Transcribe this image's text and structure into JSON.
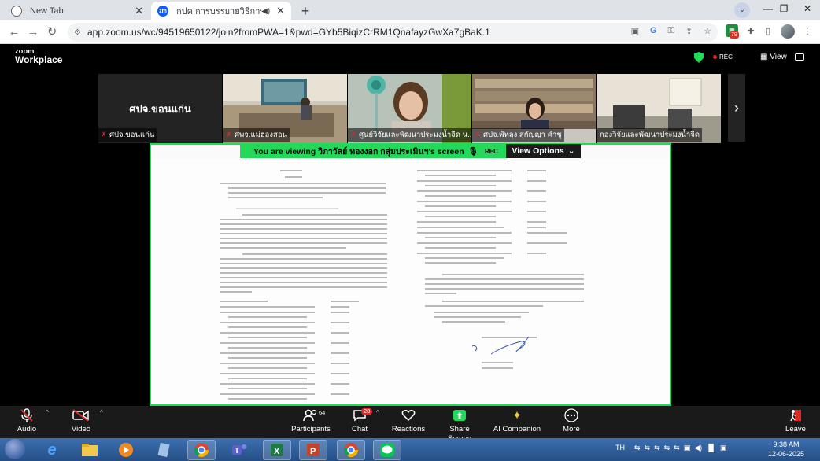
{
  "browser": {
    "tabs": [
      {
        "title": "New Tab",
        "active": false
      },
      {
        "title": "กปค.การบรรยายวิธีการลงข้อมูลแ",
        "active": true
      }
    ],
    "url": "app.zoom.us/wc/94519650122/join?fromPWA=1&pwd=GYb5BiqizCrRM1QnafayzGwXa7gBaK.1",
    "extension_badge": "79"
  },
  "zoom": {
    "brand_small": "zoom",
    "brand_large": "Workplace",
    "rec_label": "REC",
    "view_label": "View",
    "participants_thumbs": [
      {
        "name": "ศปจ.ขอนแก่น",
        "big_name": "ศปจ.ขอนแก่น",
        "muted": true
      },
      {
        "name": "ศพจ.แม่ฮ่องสอน",
        "muted": true
      },
      {
        "name": "ศูนย์วิจัยและพัฒนาประมงน้ำจืด น...",
        "muted": true
      },
      {
        "name": "ศปจ.พัทลุง สุกัญญา คำชู",
        "muted": true
      },
      {
        "name": "กองวิจัยและพัฒนาประมงน้ำจืด",
        "muted": false
      }
    ],
    "banner": {
      "viewing_text": "You are viewing  วิภาวัลย์ ทองงอก กลุ่มประเมินฯ's screen",
      "rec_label": "REC",
      "view_options_label": "View Options"
    },
    "toolbar": {
      "audio": "Audio",
      "video": "Video",
      "participants": "Participants",
      "participants_count": "64",
      "chat": "Chat",
      "chat_count": "28",
      "reactions": "Reactions",
      "share_screen": "Share Screen",
      "ai_companion": "AI Companion",
      "more": "More",
      "leave": "Leave"
    }
  },
  "taskbar": {
    "lang": "TH",
    "time": "9:38 AM",
    "date": "12-06-2025"
  }
}
